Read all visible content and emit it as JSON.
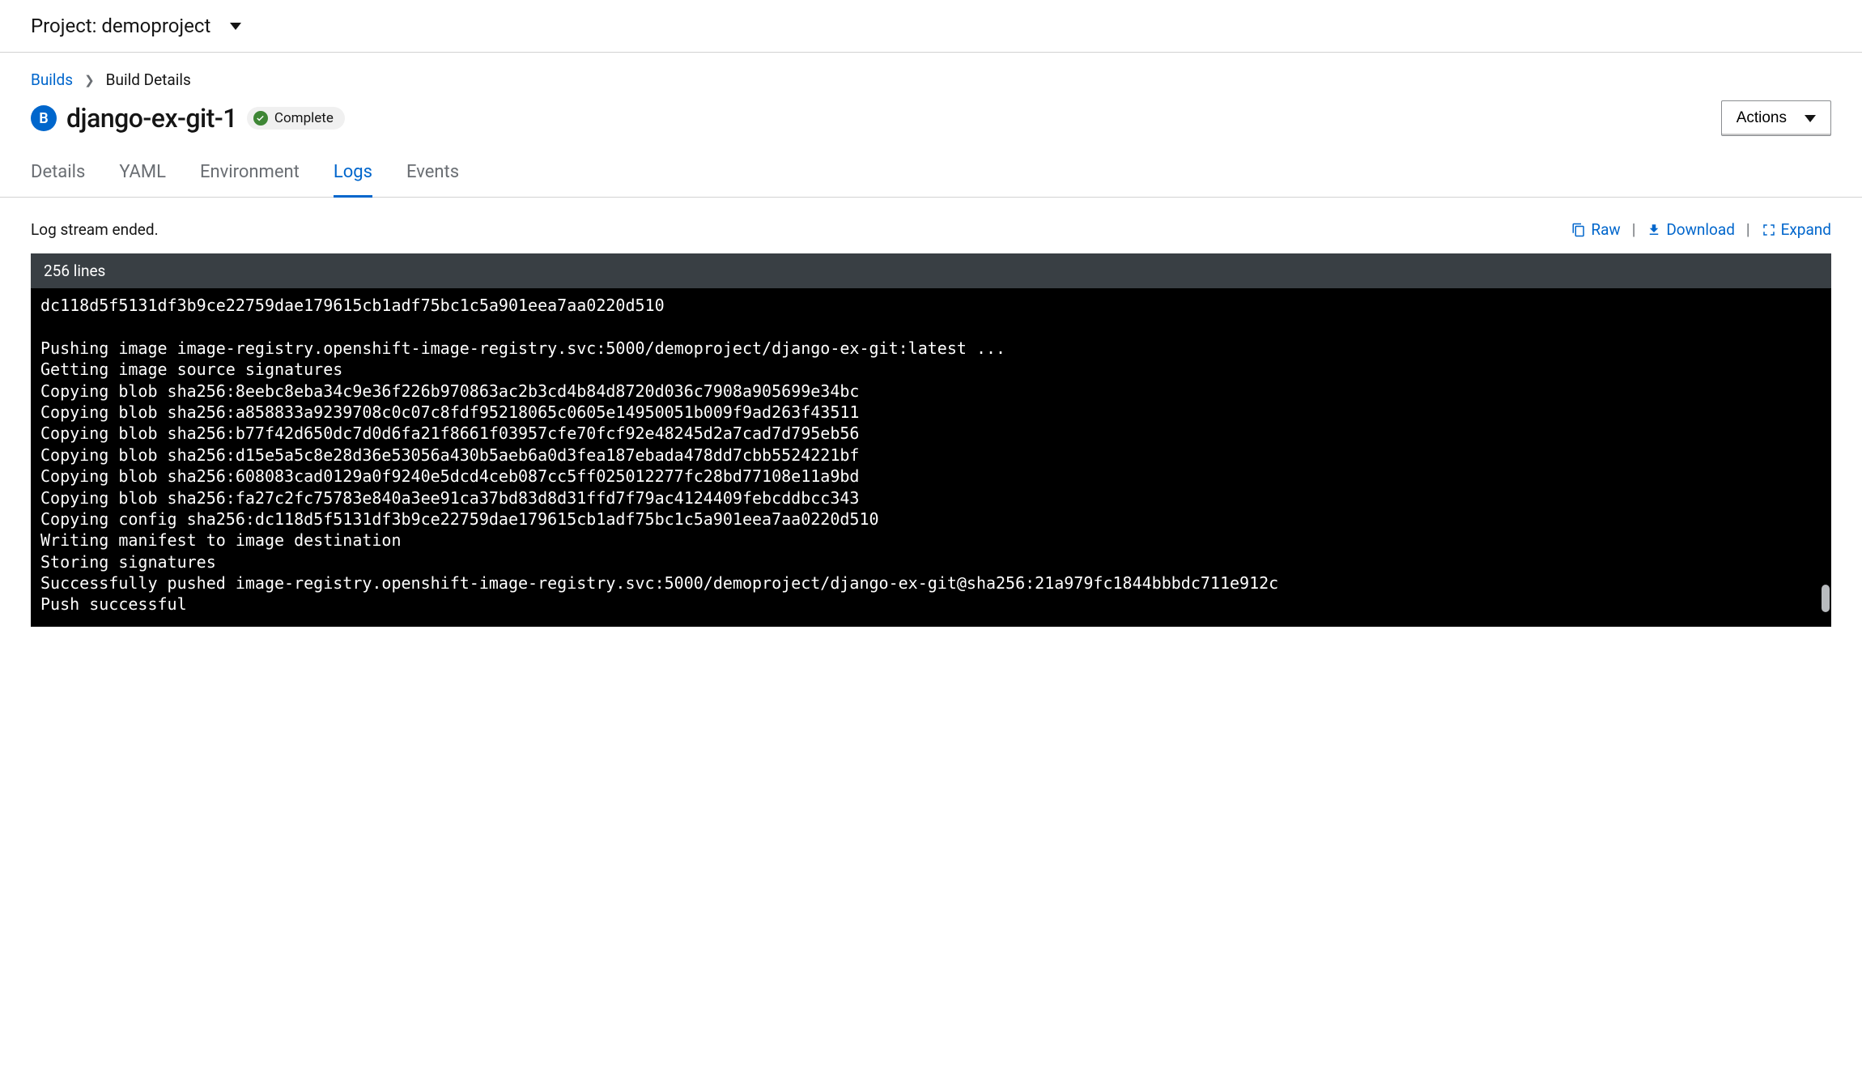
{
  "project": {
    "label": "Project: demoproject"
  },
  "breadcrumb": {
    "parent": "Builds",
    "current": "Build Details"
  },
  "header": {
    "badge_letter": "B",
    "title": "django-ex-git-1",
    "status": "Complete",
    "actions_label": "Actions"
  },
  "tabs": [
    {
      "label": "Details",
      "active": false
    },
    {
      "label": "YAML",
      "active": false
    },
    {
      "label": "Environment",
      "active": false
    },
    {
      "label": "Logs",
      "active": true
    },
    {
      "label": "Events",
      "active": false
    }
  ],
  "logs": {
    "status_text": "Log stream ended.",
    "actions": {
      "raw": "Raw",
      "download": "Download",
      "expand": "Expand"
    },
    "line_count_label": "256 lines",
    "content": "dc118d5f5131df3b9ce22759dae179615cb1adf75bc1c5a901eea7aa0220d510\n\nPushing image image-registry.openshift-image-registry.svc:5000/demoproject/django-ex-git:latest ...\nGetting image source signatures\nCopying blob sha256:8eebc8eba34c9e36f226b970863ac2b3cd4b84d8720d036c7908a905699e34bc\nCopying blob sha256:a858833a9239708c0c07c8fdf95218065c0605e14950051b009f9ad263f43511\nCopying blob sha256:b77f42d650dc7d0d6fa21f8661f03957cfe70fcf92e48245d2a7cad7d795eb56\nCopying blob sha256:d15e5a5c8e28d36e53056a430b5aeb6a0d3fea187ebada478dd7cbb5524221bf\nCopying blob sha256:608083cad0129a0f9240e5dcd4ceb087cc5ff025012277fc28bd77108e11a9bd\nCopying blob sha256:fa27c2fc75783e840a3ee91ca37bd83d8d31ffd7f79ac4124409febcddbcc343\nCopying config sha256:dc118d5f5131df3b9ce22759dae179615cb1adf75bc1c5a901eea7aa0220d510\nWriting manifest to image destination\nStoring signatures\nSuccessfully pushed image-registry.openshift-image-registry.svc:5000/demoproject/django-ex-git@sha256:21a979fc1844bbbdc711e912c\nPush successful"
  }
}
